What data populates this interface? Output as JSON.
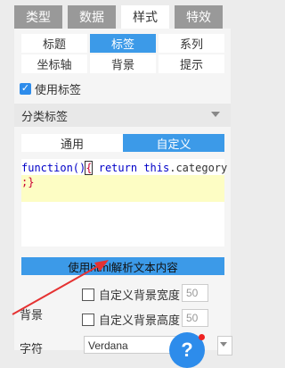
{
  "tabs": [
    "类型",
    "数据",
    "样式",
    "特效"
  ],
  "subtabs": [
    "标题",
    "标签",
    "系列",
    "坐标轴",
    "背景",
    "提示"
  ],
  "use_label_checkbox": {
    "label": "使用标签",
    "checked": true
  },
  "category_dropdown": {
    "label": "分类标签"
  },
  "mode_toggle": [
    "通用",
    "自定义"
  ],
  "code": {
    "line1_fn": "function",
    "line1_parens": "()",
    "line1_brace": "{",
    "line1_return": "return",
    "line1_this": "this",
    "line1_prop": ".category",
    "line2": ";}"
  },
  "html_button": {
    "label": "使用html解析文本内容"
  },
  "background": {
    "label": "背景",
    "custom_width": {
      "label": "自定义背景宽度",
      "value": "50"
    },
    "custom_height": {
      "label": "自定义背景高度",
      "value": "50"
    }
  },
  "font": {
    "label": "字符",
    "value": "Verdana"
  },
  "colors": {
    "accent": "#3c9ae8",
    "annotation": "#e53232"
  }
}
